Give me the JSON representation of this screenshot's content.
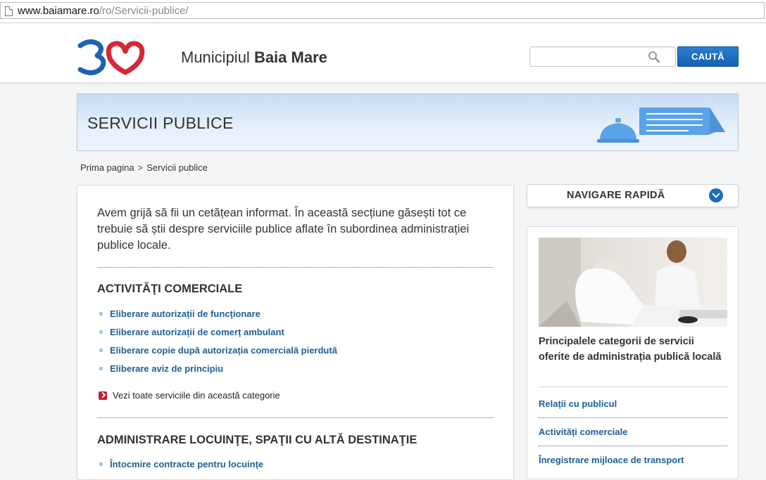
{
  "browser": {
    "url_host": "www.baiamare.ro",
    "url_path": "/ro/Servicii-publice/"
  },
  "header": {
    "site_title_light": "Municipiul ",
    "site_title_bold": "Baia Mare",
    "search": {
      "placeholder": "",
      "value": "",
      "button_label": "CAUTĂ"
    }
  },
  "banner": {
    "title": "SERVICII PUBLICE"
  },
  "breadcrumb": {
    "home": "Prima pagina",
    "separator": ">",
    "current": "Servicii publice"
  },
  "main": {
    "intro": "Avem grijă să fii un cetățean informat. În această secțiune găsești tot ce trebuie să știi despre serviciile publice aflate în subordinea administrației publice locale.",
    "sections": [
      {
        "heading": "ACTIVITĂŢI COMERCIALE",
        "links": [
          "Eliberare autorizații de funcționare",
          "Eliberare autorizații de comerț ambulant",
          "Eliberare copie după autorizația comercială pierdută",
          "Eliberare aviz de principiu"
        ],
        "see_all": "Vezi toate serviciile din această categorie"
      },
      {
        "heading": "ADMINISTRARE LOCUINŢE, SPAŢII CU ALTĂ DESTINAŢIE",
        "links": [
          "Întocmire contracte pentru locuințe"
        ]
      }
    ]
  },
  "sidebar": {
    "quick_nav_label": "NAVIGARE RAPIDĂ",
    "card_title": "Principalele categorii de servicii oferite de administrația publică locală",
    "links": [
      "Relații cu publicul",
      "Activități comerciale",
      "Înregistrare mijloace de transport"
    ]
  },
  "colors": {
    "link": "#1f5e96",
    "search_button": "#1561b1",
    "banner_top": "#c7dcf3",
    "bullet_arrow": "#c91e2c",
    "logo_blue": "#1b63b4",
    "logo_red": "#d62637"
  }
}
